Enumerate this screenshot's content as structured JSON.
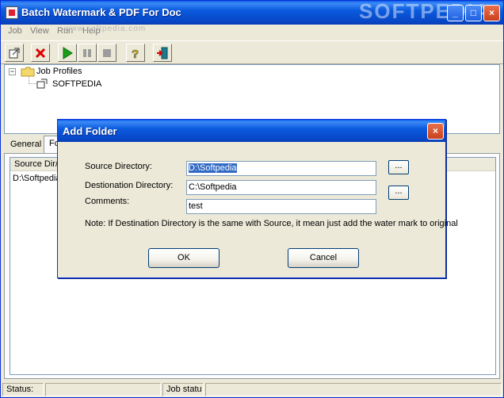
{
  "window": {
    "title": "Batch Watermark & PDF For Doc",
    "controls": {
      "minimize": "_",
      "maximize": "□",
      "close": "×"
    }
  },
  "watermark_text": "www.softpedia.com",
  "logo_text": "SOFTPEDIA",
  "menu": [
    "Job",
    "View",
    "Run",
    "Help"
  ],
  "toolbar": {
    "buttons": [
      "new-job-icon",
      "delete-icon",
      "run-icon",
      "pause-icon",
      "stop-icon",
      "help-icon",
      "exit-icon"
    ]
  },
  "tree": {
    "expander": "−",
    "root": "Job Profiles",
    "child": "SOFTPEDIA"
  },
  "tabs": [
    "General",
    "Fo"
  ],
  "list": {
    "header": "Source Dir/F",
    "row": "D:\\Softpedia"
  },
  "statusbar": {
    "status": "Status:",
    "job_status": "Job statu"
  },
  "dialog": {
    "title": "Add Folder",
    "close": "×",
    "source_label": "Source Directory:",
    "source_value": "D:\\Softpedia",
    "dest_label": "Destionation Directory:",
    "dest_value": "C:\\Softpedia",
    "comments_label": "Comments:",
    "comments_value": "test",
    "browse_label": "...",
    "note": "Note: If Destination Directory is the same with Source, it mean just add the water mark to original",
    "ok": "OK",
    "cancel": "Cancel"
  }
}
